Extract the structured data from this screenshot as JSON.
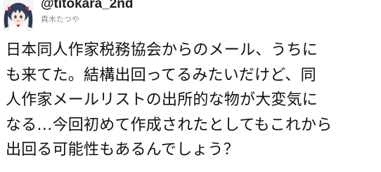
{
  "tweet": {
    "handle": "@titokara_2nd",
    "display_name": "真木たつや",
    "avatar_icon": "anime-character-avatar-icon",
    "lines": [
      "日本同人作家税務協会からのメール、うちに",
      "も来てた。結構出回ってるみたいだけど、同",
      "人作家メールリストの出所的な物が大変気に",
      "なる…今回初めて作成されたとしてもこれから",
      "出回る可能性もあるんでしょう？"
    ]
  },
  "colors": {
    "background": "#ffffff",
    "handle": "#222222",
    "display_name": "#8a8a8a",
    "text": "#111111"
  }
}
